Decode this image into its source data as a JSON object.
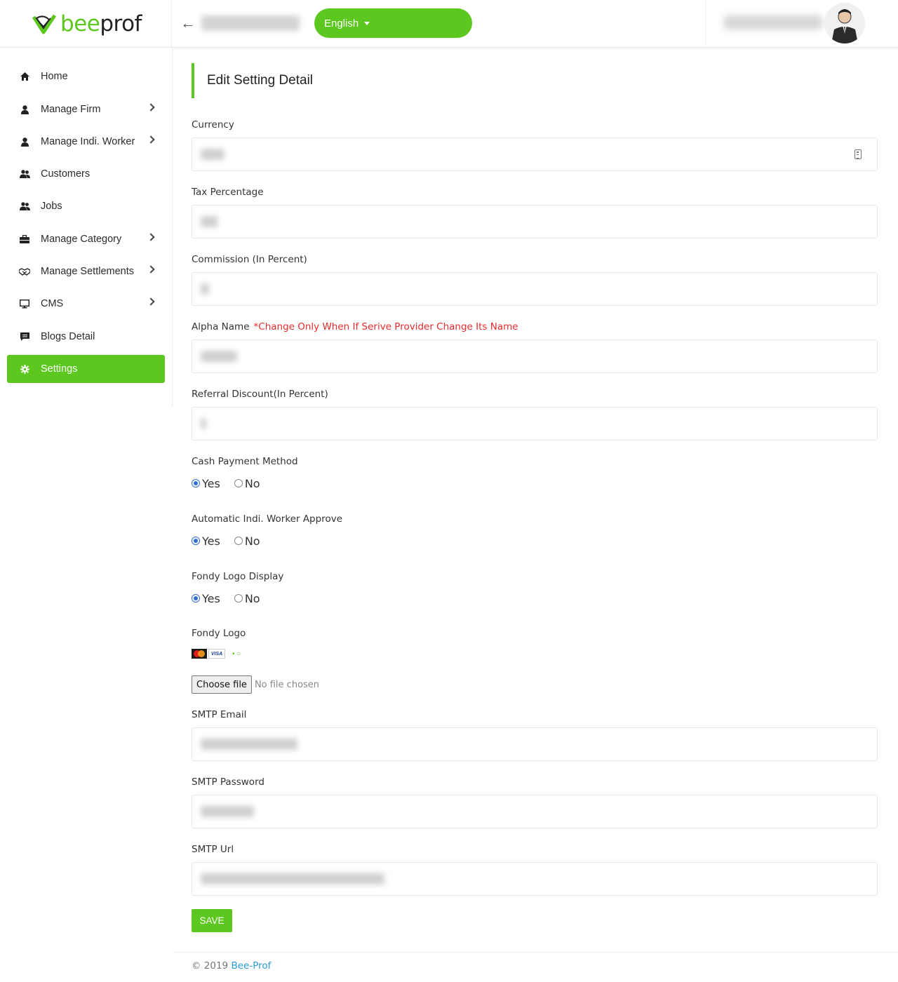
{
  "header": {
    "logo_bee": "bee",
    "logo_prof": "prof",
    "back_icon": "arrow-left-icon",
    "language": "English",
    "language_icon": "caret-down-icon"
  },
  "sidebar": {
    "items": [
      {
        "label": "Home",
        "icon": "home-icon",
        "has_submenu": false
      },
      {
        "label": "Manage Firm",
        "icon": "user-icon",
        "has_submenu": true
      },
      {
        "label": "Manage Indi. Worker",
        "icon": "user-icon",
        "has_submenu": true
      },
      {
        "label": "Customers",
        "icon": "users-icon",
        "has_submenu": false
      },
      {
        "label": "Jobs",
        "icon": "users-icon",
        "has_submenu": false
      },
      {
        "label": "Manage Category",
        "icon": "briefcase-icon",
        "has_submenu": true
      },
      {
        "label": "Manage Settlements",
        "icon": "handshake-icon",
        "has_submenu": true
      },
      {
        "label": "CMS",
        "icon": "monitor-icon",
        "has_submenu": true
      },
      {
        "label": "Blogs Detail",
        "icon": "comment-icon",
        "has_submenu": false
      },
      {
        "label": "Settings",
        "icon": "gear-icon",
        "has_submenu": false,
        "active": true
      }
    ]
  },
  "form": {
    "title": "Edit Setting Detail",
    "currency_label": "Currency",
    "tax_label": "Tax Percentage",
    "commission_label": "Commission (In Percent)",
    "alpha_name_label": "Alpha Name",
    "alpha_name_note": "*Change Only When If Serive Provider Change Its Name",
    "referral_label": "Referral Discount(In Percent)",
    "cash_payment_label": "Cash Payment Method",
    "auto_approve_label": "Automatic Indi. Worker Approve",
    "fondy_display_label": "Fondy Logo Display",
    "fondy_logo_label": "Fondy Logo",
    "yes_label": "Yes",
    "no_label": "No",
    "visa_text": "VISA",
    "choose_file_label": "Choose file",
    "file_status": "No file chosen",
    "smtp_email_label": "SMTP Email",
    "smtp_password_label": "SMTP Password",
    "smtp_url_label": "SMTP Url",
    "save_label": "SAVE",
    "cash_payment_value": "Yes",
    "auto_approve_value": "Yes",
    "fondy_display_value": "Yes"
  },
  "footer": {
    "copyright": "© 2019 ",
    "brand": "Bee-Prof"
  },
  "colors": {
    "accent": "#5cc71e",
    "note_red": "#e52b2b",
    "link_blue": "#2b9bd6"
  }
}
